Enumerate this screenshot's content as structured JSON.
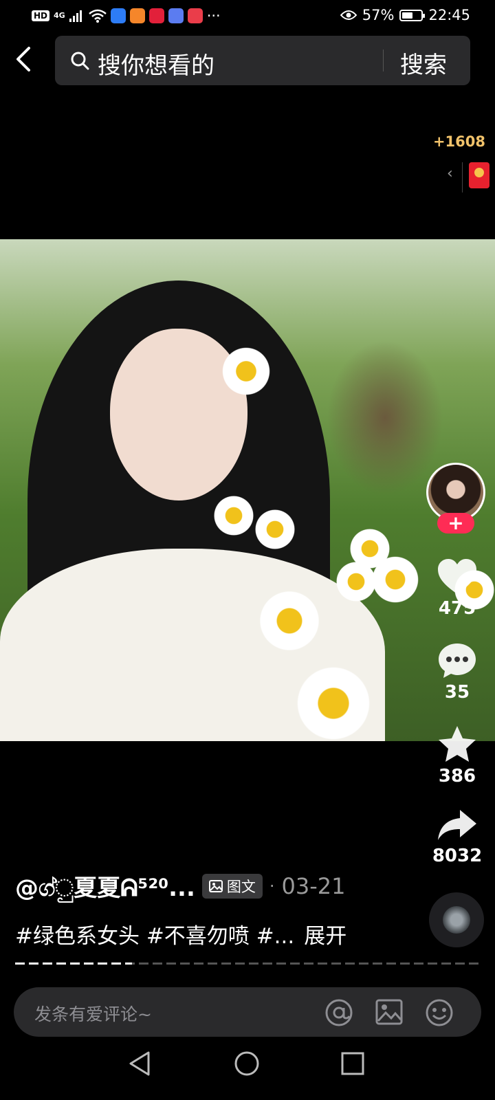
{
  "status_bar": {
    "hd": "HD",
    "network": "4G",
    "eye_percent": "57%",
    "battery_level": 0.57,
    "time": "22:45",
    "more": "···"
  },
  "search": {
    "placeholder": "搜你想看的",
    "button_label": "搜索"
  },
  "reward": {
    "count": "+1608",
    "arrow": "‹"
  },
  "actions": {
    "follow": "+",
    "likes": "475",
    "comments": "35",
    "favorites": "386",
    "shares": "8032"
  },
  "post": {
    "author": "@ග්ුු夏夏ᕱ⁵²⁰...",
    "type_tag": "图文",
    "separator": "·",
    "date": "03-21",
    "description": "#绿色系女头 #不喜勿喷 #...",
    "expand": "展开",
    "progress_pages": 1,
    "progress_total": 4
  },
  "comment": {
    "placeholder": "发条有爱评论~"
  },
  "colors": {
    "accent_red": "#fe2c55",
    "reward_gold": "#f2c36b"
  }
}
